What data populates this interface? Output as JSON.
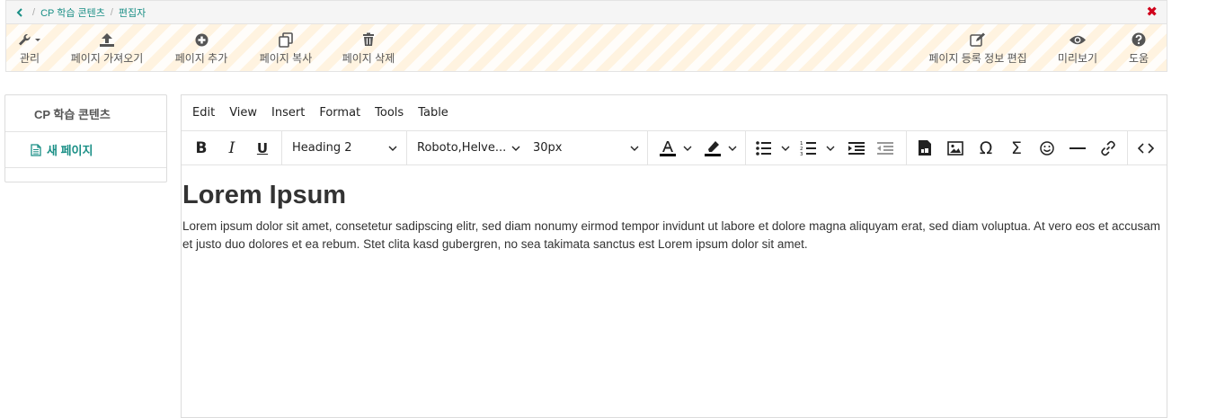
{
  "breadcrumb": {
    "items": [
      "CP 학습 콘텐츠",
      "편집자"
    ]
  },
  "toolbar": {
    "manage_label": "관리",
    "import_label": "페이지 가져오기",
    "add_label": "페이지 추가",
    "copy_label": "페이지 복사",
    "delete_label": "페이지 삭제",
    "edit_info_label": "페이지 등록 정보 편집",
    "preview_label": "미리보기",
    "help_label": "도움"
  },
  "sidebar": {
    "title": "CP 학습 콘텐츠",
    "pages": [
      "새 페이지"
    ]
  },
  "editor": {
    "menu": [
      "Edit",
      "View",
      "Insert",
      "Format",
      "Tools",
      "Table"
    ],
    "block_format": "Heading 2",
    "font_family": "Roboto,Helve...",
    "font_size": "30px",
    "heading": "Lorem Ipsum",
    "paragraph": "Lorem ipsum dolor sit amet, consetetur sadipscing elitr, sed diam nonumy eirmod tempor invidunt ut labore et dolore magna aliquyam erat, sed diam voluptua. At vero eos et accusam et justo duo dolores et ea rebum. Stet clita kasd gubergren, no sea takimata sanctus est Lorem ipsum dolor sit amet."
  },
  "colors": {
    "accent": "#1a8f86",
    "close": "#d0021b",
    "stripe": "#fff3e0"
  }
}
